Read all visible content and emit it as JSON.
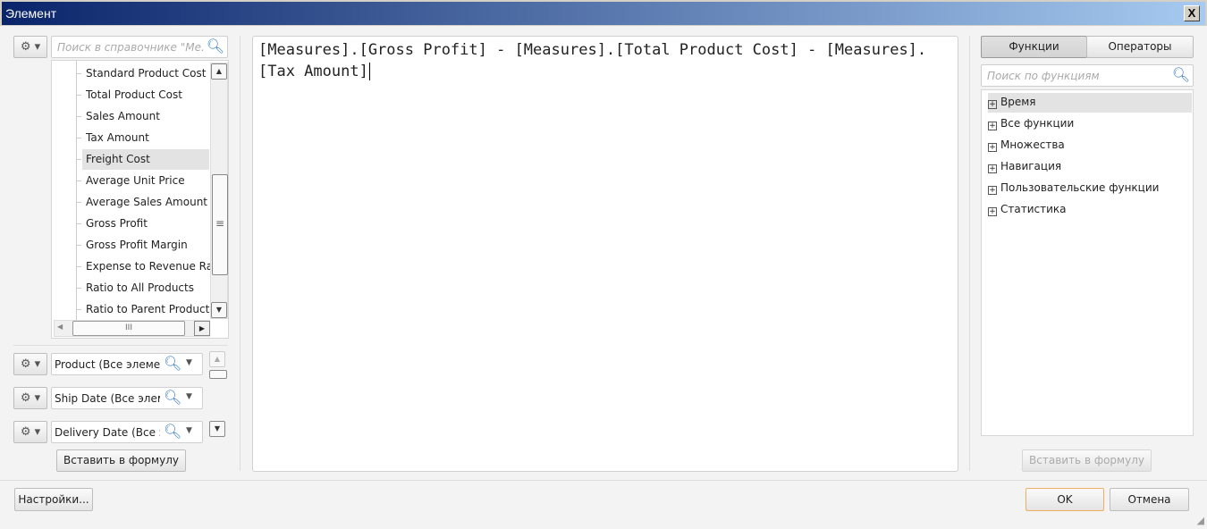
{
  "window": {
    "title": "Элемент",
    "close": "X"
  },
  "left": {
    "search_placeholder": "Поиск в справочнике \"Ме...",
    "tree_items": [
      {
        "label": "Standard Product Cost"
      },
      {
        "label": "Total Product Cost"
      },
      {
        "label": "Sales Amount"
      },
      {
        "label": "Tax Amount"
      },
      {
        "label": "Freight Cost",
        "selected": true
      },
      {
        "label": "Average Unit Price"
      },
      {
        "label": "Average Sales Amount"
      },
      {
        "label": "Gross Profit"
      },
      {
        "label": "Gross Profit Margin"
      },
      {
        "label": "Expense to Revenue Ratio"
      },
      {
        "label": "Ratio to All Products"
      },
      {
        "label": "Ratio to Parent Product"
      }
    ],
    "filters": [
      {
        "value": "Product (Все элементы)"
      },
      {
        "value": "Ship Date (Все элементы)"
      },
      {
        "value": "Delivery Date (Все элементы)"
      }
    ],
    "insert_button": "Вставить в формулу"
  },
  "editor": {
    "formula": "[Measures].[Gross Profit] - [Measures].[Total Product Cost] - [Measures].[Tax Amount]"
  },
  "right": {
    "tabs": [
      {
        "label": "Функции"
      },
      {
        "label": "Операторы"
      }
    ],
    "active_tab": "Функции",
    "search_placeholder": "Поиск по функциям",
    "categories": [
      {
        "label": "Время",
        "selected": true
      },
      {
        "label": "Все функции"
      },
      {
        "label": "Множества"
      },
      {
        "label": "Навигация"
      },
      {
        "label": "Пользовательские функции"
      },
      {
        "label": "Статистика"
      }
    ],
    "insert_button": "Вставить в формулу",
    "insert_disabled": true
  },
  "footer": {
    "settings": "Настройки...",
    "ok": "OK",
    "cancel": "Отмена"
  }
}
